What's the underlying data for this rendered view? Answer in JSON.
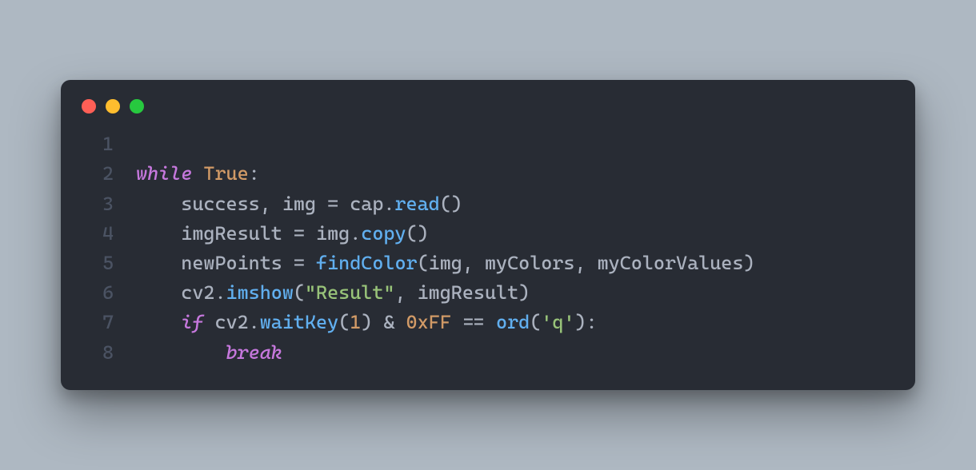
{
  "window": {
    "traffic_lights": [
      "close",
      "minimize",
      "zoom"
    ]
  },
  "code": {
    "line_numbers": [
      "1",
      "2",
      "3",
      "4",
      "5",
      "6",
      "7",
      "8"
    ],
    "lines": {
      "l2": {
        "while": "while",
        "true": "True",
        "colon": ":"
      },
      "l3": {
        "success": "success",
        "comma": ", ",
        "img": "img",
        "eq": " = ",
        "cap": "cap",
        "dot": ".",
        "read": "read",
        "parens": "()"
      },
      "l4": {
        "imgResult": "imgResult",
        "eq": " = ",
        "img": "img",
        "dot": ".",
        "copy": "copy",
        "parens": "()"
      },
      "l5": {
        "newPoints": "newPoints",
        "eq": " = ",
        "findColor": "findColor",
        "lp": "(",
        "img": "img",
        "c1": ", ",
        "myColors": "myColors",
        "c2": ", ",
        "myColorValues": "myColorValues",
        "rp": ")"
      },
      "l6": {
        "cv2": "cv2",
        "dot": ".",
        "imshow": "imshow",
        "lp": "(",
        "str": "\"Result\"",
        "c": ", ",
        "imgResult": "imgResult",
        "rp": ")"
      },
      "l7": {
        "if": "if",
        "cv2": "cv2",
        "dot": ".",
        "waitKey": "waitKey",
        "lp": "(",
        "one": "1",
        "rp": ")",
        "amp": " & ",
        "hex": "0xFF",
        "eqeq": " == ",
        "ord": "ord",
        "lp2": "(",
        "q": "'q'",
        "rp2": ")",
        "colon": ":"
      },
      "l8": {
        "break": "break"
      }
    }
  }
}
